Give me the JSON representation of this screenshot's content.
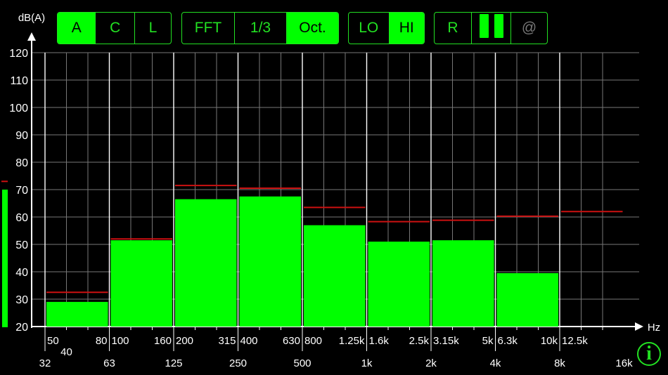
{
  "toolbar": {
    "weighting": {
      "items": [
        "A",
        "C",
        "L"
      ],
      "active": "A"
    },
    "analysis": {
      "items": [
        "FFT",
        "1/3",
        "Oct."
      ],
      "active": "Oct."
    },
    "range": {
      "items": [
        "LO",
        "HI"
      ],
      "active": "HI"
    },
    "controls": {
      "reset_label": "R",
      "pause_icon": "pause-icon",
      "at_label": "@"
    }
  },
  "info_icon": "info-icon",
  "info_label": "i",
  "colors": {
    "accent": "#00ff00",
    "peak": "#cc1111",
    "grid": "#777777"
  },
  "chart_data": {
    "type": "bar",
    "ylabel": "dB(A)",
    "xlabel": "Hz",
    "ylim": [
      20,
      120
    ],
    "yticks": [
      20,
      30,
      40,
      50,
      60,
      70,
      80,
      90,
      100,
      110,
      120
    ],
    "categories": [
      "63",
      "125",
      "250",
      "500",
      "1k",
      "2k",
      "4k",
      "8k",
      "16k"
    ],
    "values": [
      29,
      51.5,
      66.5,
      67.5,
      57,
      51,
      51.5,
      39.5,
      null
    ],
    "peaks": [
      32.5,
      52,
      71.5,
      70.5,
      63.5,
      58.3,
      58.8,
      60.3,
      62
    ],
    "level_meter": {
      "value": 70,
      "peak": 73
    },
    "tick_rows": {
      "row1": [
        "50",
        "80",
        "100",
        "160",
        "200",
        "315",
        "400",
        "630",
        "800",
        "1.25k",
        "1.6k",
        "2.5k",
        "3.15k",
        "5k",
        "6.3k",
        "10k",
        "12.5k"
      ],
      "row2": [
        "40"
      ],
      "row3": [
        "32",
        "63",
        "125",
        "250",
        "500",
        "1k",
        "2k",
        "4k",
        "8k",
        "16k"
      ]
    }
  }
}
